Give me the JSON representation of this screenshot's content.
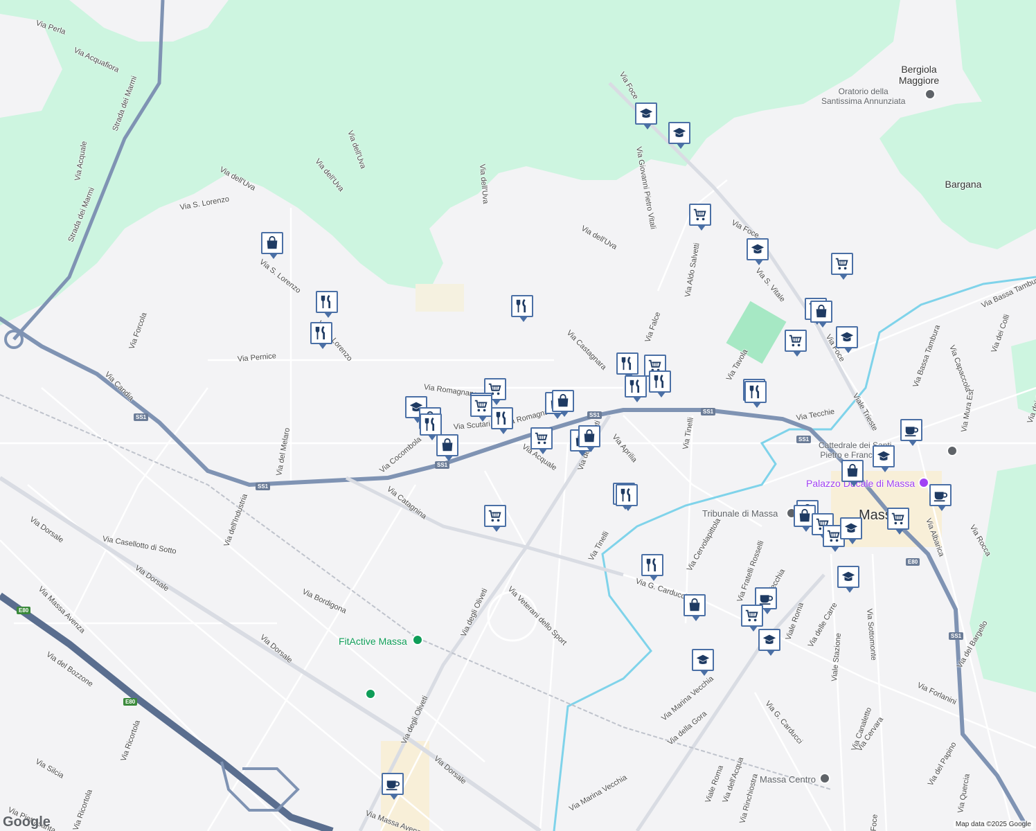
{
  "map": {
    "colors": {
      "background": "#f3f3f5",
      "park": "#cdf5e0",
      "park_dark": "#a6e8c4",
      "river": "#7fd3ea",
      "highway": "#7f93b3",
      "road": "#d9dce3",
      "marker_border": "#4a6fa5",
      "marker_icon": "#1f3b63",
      "poi_green": "#0f9d58",
      "poi_purple": "#a142f4"
    },
    "street_labels": [
      "Via Perla",
      "Via Acquafiora",
      "Strada dei Marmi",
      "Strada dei Marmi",
      "Via Acquale",
      "Via dell'Uva",
      "Via dell'Uva",
      "Via dell'Uva",
      "Via dell'Uva",
      "Via S. Lorenzo",
      "Via S. Lorenzo",
      "Via S. Lorenzo",
      "Via Foce",
      "Via Giovanni Pietro Vitali",
      "Via dell'Uva",
      "Via Foce",
      "Via Aldo Salvetti",
      "Via S. Vitale",
      "Via Castagnara",
      "Via Falce",
      "Via Tavola",
      "Via Pernice",
      "Via Forcola",
      "Via Candia",
      "Via Romagnano",
      "Via Romagnano",
      "Via Scutari",
      "Via Cocombola",
      "Via Acquale",
      "Via degli Oliveti",
      "Via Aprilia",
      "Via Tinelli",
      "Via Tecchie",
      "Viale Trieste",
      "Via Foce",
      "Via Bassa Tambura",
      "Via Bassa Tambura",
      "Via Capaccola",
      "Via dei Colli",
      "Via dei Colli",
      "Via Mura Est",
      "Via Albarica",
      "Via Rocca",
      "Via del Melaro",
      "Via dell'Industria",
      "Via Catagnina",
      "Via Dorsale",
      "Via Casellotto di Sotto",
      "Via Dorsale",
      "Via Bordigona",
      "Via Dorsale",
      "Via Massa Avenza",
      "Via del Bozzone",
      "Via degli Oliveti",
      "Via Veterani dello Sport",
      "Via Tinelli",
      "Via G. Carducci",
      "Via Cervolapittola",
      "Via Fratelli Rosselli",
      "Via Marina Vecchia",
      "Viale Roma",
      "Via delle Carre",
      "Viale Stazione",
      "Via Sottomonte",
      "Via del Bargello",
      "Via Forlanini",
      "Via Marina Vecchia",
      "Via della Gora",
      "Via G. Carducci",
      "Via Canaletto",
      "Via Cervara",
      "Via degli Oliveti",
      "Via Ricortola",
      "Via Silcia",
      "Via Dorsale",
      "Via Marina Vecchia",
      "Viale Roma",
      "Via dell'Acqua",
      "Via Rinchiostra",
      "Via del Papino",
      "Via Quercia",
      "Via Pietrasanta",
      "Via Ricortola",
      "Via Massa Avenza",
      "Via Foce"
    ],
    "place_labels": [
      {
        "name": "Bergiola\nMaggiore"
      },
      {
        "name": "Bargana"
      }
    ],
    "poi_labels": [
      {
        "name": "Oratorio della\nSantissima Annunziata",
        "color": "#5f6368"
      },
      {
        "name": "Cattedrale dei Santi\nPietro e Francesco",
        "color": "#5f6368"
      },
      {
        "name": "Palazzo Ducale di Massa",
        "color": "#a142f4"
      },
      {
        "name": "Tribunale di Massa",
        "color": "#5f6368"
      },
      {
        "name": "Massa",
        "color": "#333333"
      },
      {
        "name": "FitActive Massa",
        "color": "#0f9d58"
      },
      {
        "name": "Massa Centro",
        "color": "#5f6368"
      }
    ],
    "shields": [
      "SS1",
      "SS1",
      "SS1",
      "SS1",
      "SS1",
      "SS1",
      "SS1",
      "E80",
      "E80",
      "E80"
    ],
    "markers": [
      "cart-icon",
      "shopping-bag-icon",
      "restaurant-icon",
      "school-icon",
      "cafe-icon"
    ],
    "attribution": "Map data ©2025 Google",
    "logo": "Google"
  }
}
